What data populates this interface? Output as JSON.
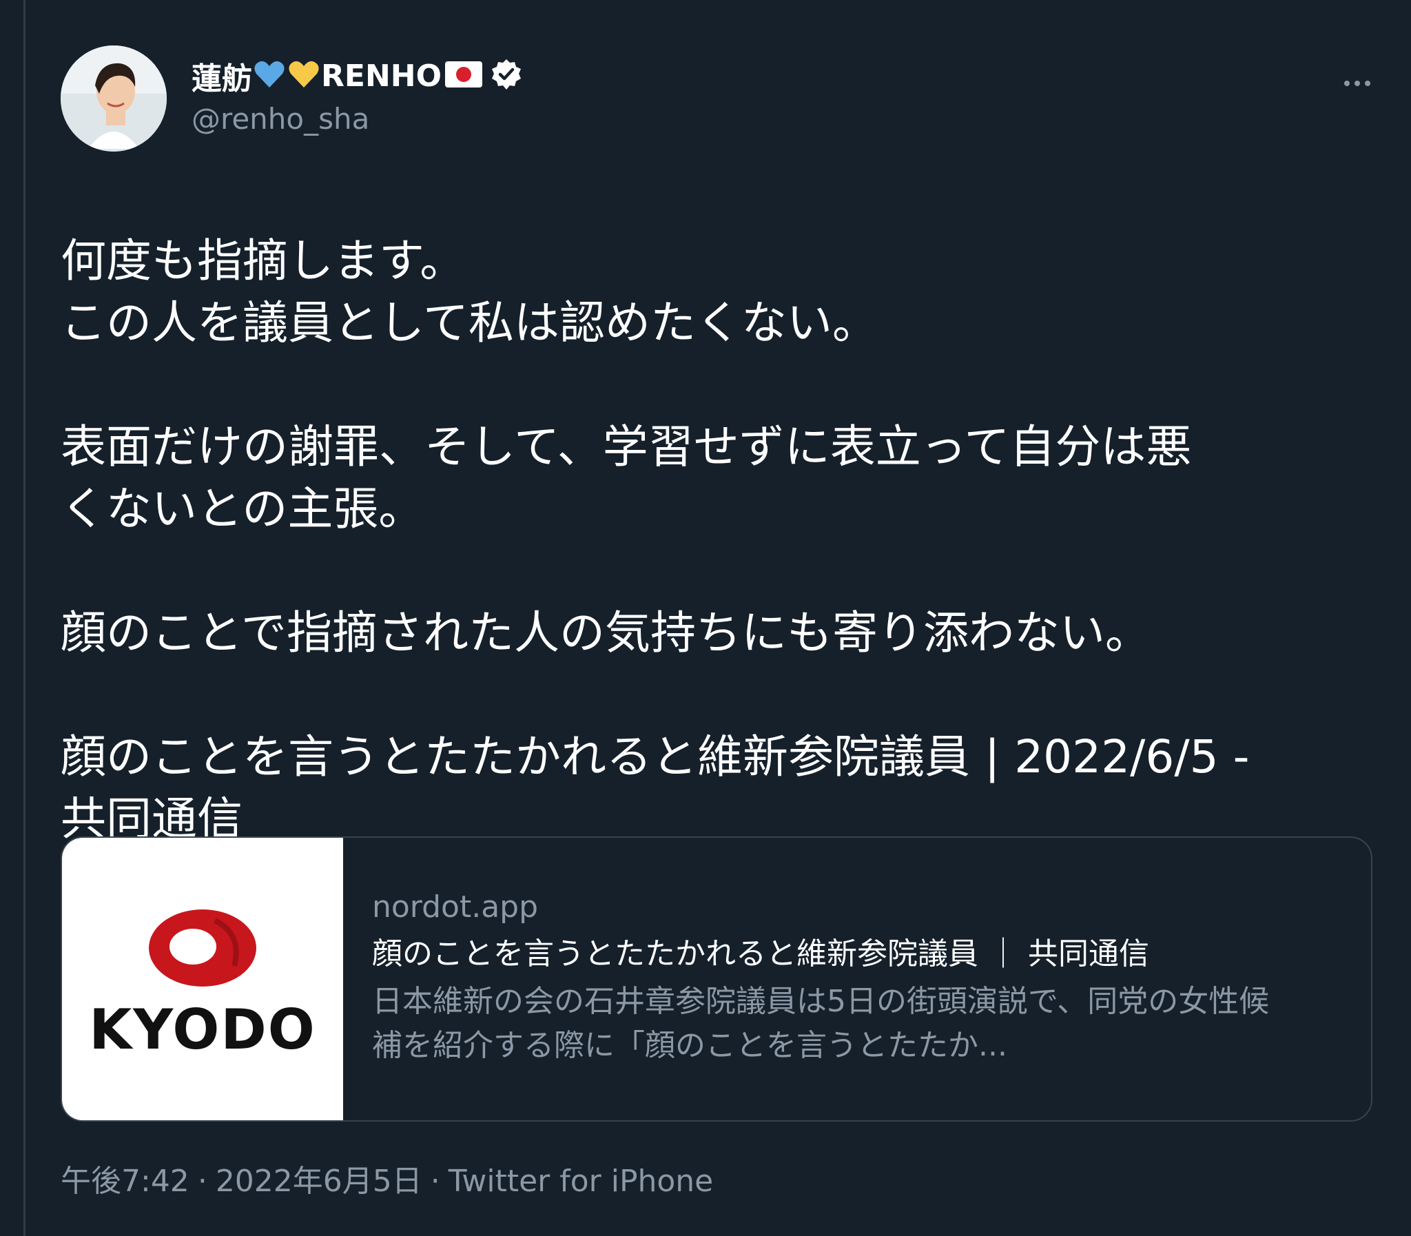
{
  "colors": {
    "background": "#15202b",
    "text_primary": "#ffffff",
    "text_secondary": "#8b98a5",
    "border": "#38444d",
    "verified_badge": "#ffffff",
    "heart_blue": "#5aa9e6",
    "heart_yellow": "#f7c948",
    "kyodo_red": "#c8161d"
  },
  "author": {
    "name": "蓮舫",
    "name_suffix": "RENHO",
    "handle": "@renho_sha",
    "emoji": [
      "blue-heart-icon",
      "yellow-heart-icon",
      "japan-flag-icon"
    ],
    "verified": true
  },
  "tweet": {
    "paragraphs": [
      [
        "何度も指摘します。",
        "この人を議員として私は認めたくない。"
      ],
      [
        "表面だけの謝罪、そして、学習せずに表立って自分は悪",
        "くないとの主張。"
      ],
      [
        "顔のことで指摘された人の気持ちにも寄り添わない。"
      ],
      [
        "顔のことを言うとたたかれると維新参院議員 | 2022/6/5 -",
        "共同通信"
      ]
    ]
  },
  "card": {
    "thumbnail_logo_text": "KYODO",
    "domain": "nordot.app",
    "title": "顔のことを言うとたたかれると維新参院議員 ｜ 共同通信",
    "description_line1": "日本維新の会の石井章参院議員は5日の街頭演説で、同党の女性候",
    "description_line2": "補を紹介する際に「顔のことを言うとたたか..."
  },
  "meta": {
    "time": "午後7:42",
    "date": "2022年6月5日",
    "source": "Twitter for iPhone",
    "separator": "·"
  }
}
